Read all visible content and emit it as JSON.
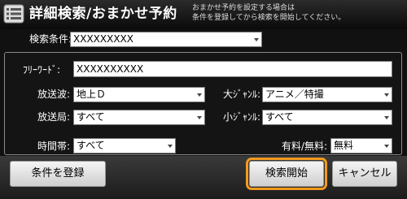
{
  "header": {
    "title": "詳細検索/おまかせ予約",
    "hint_line1": "おまかせ予約を設定する場合は",
    "hint_line2": "条件を登録してから検索を開始してください。"
  },
  "condition": {
    "label": "検索条件:",
    "value": "XXXXXXXXX"
  },
  "form": {
    "free_word_label": "ﾌﾘｰﾜｰﾄﾞ:",
    "free_word_value": "XXXXXXXXXX",
    "broadcast_wave_label": "放送波:",
    "broadcast_wave_value": "地上Ｄ",
    "major_genre_label": "大ｼﾞｬﾝﾙ:",
    "major_genre_value": "アニメ／特撮",
    "station_label": "放送局:",
    "station_value": "すべて",
    "minor_genre_label": "小ｼﾞｬﾝﾙ:",
    "minor_genre_value": "すべて",
    "time_label": "時間帯:",
    "time_value": "すべて",
    "fee_label": "有料/無料:",
    "fee_value": "無料"
  },
  "footer": {
    "register_label": "条件を登録",
    "search_label": "検索開始",
    "cancel_label": "キャンセル"
  },
  "colors": {
    "focus": "#f39a1d"
  }
}
